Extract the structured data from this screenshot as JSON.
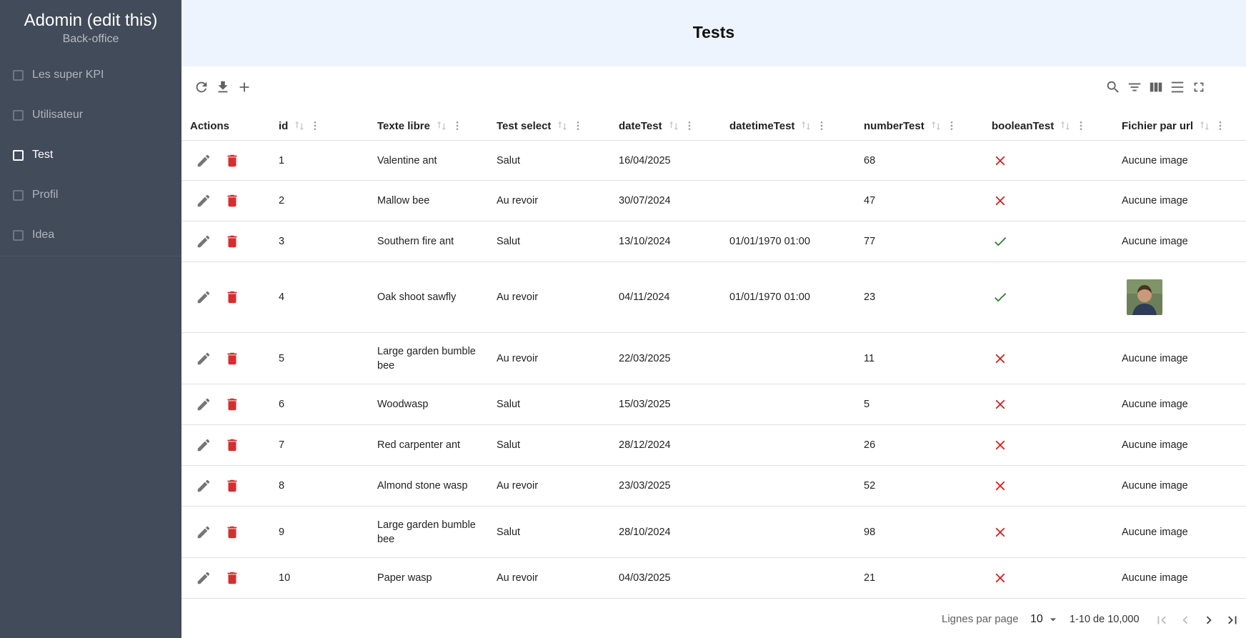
{
  "sidebar": {
    "title": "Adomin (edit this)",
    "subtitle": "Back-office",
    "items": [
      {
        "label": "Les super KPI",
        "active": false
      },
      {
        "label": "Utilisateur",
        "active": false
      },
      {
        "label": "Test",
        "active": true
      },
      {
        "label": "Profil",
        "active": false
      },
      {
        "label": "Idea",
        "active": false
      }
    ]
  },
  "header": {
    "title": "Tests"
  },
  "toolbar": {
    "left": [
      "refresh-icon",
      "download-icon",
      "add-icon"
    ],
    "right": [
      "search-icon",
      "filter-icon",
      "columns-icon",
      "density-icon",
      "fullscreen-icon"
    ]
  },
  "table": {
    "columns": [
      "Actions",
      "id",
      "Texte libre",
      "Test select",
      "dateTest",
      "datetimeTest",
      "numberTest",
      "booleanTest",
      "Fichier par url"
    ],
    "rows": [
      {
        "id": "1",
        "texte": "Valentine ant",
        "select": "Salut",
        "date": "16/04/2025",
        "datetime": "",
        "number": "68",
        "bool": false,
        "fichier": "Aucune image"
      },
      {
        "id": "2",
        "texte": "Mallow bee",
        "select": "Au revoir",
        "date": "30/07/2024",
        "datetime": "",
        "number": "47",
        "bool": false,
        "fichier": "Aucune image"
      },
      {
        "id": "3",
        "texte": "Southern fire ant",
        "select": "Salut",
        "date": "13/10/2024",
        "datetime": "01/01/1970 01:00",
        "number": "77",
        "bool": true,
        "fichier": "Aucune image"
      },
      {
        "id": "4",
        "texte": "Oak shoot sawfly",
        "select": "Au revoir",
        "date": "04/11/2024",
        "datetime": "01/01/1970 01:00",
        "number": "23",
        "bool": true,
        "fichier": ""
      },
      {
        "id": "5",
        "texte": "Large garden bumble bee",
        "select": "Au revoir",
        "date": "22/03/2025",
        "datetime": "",
        "number": "11",
        "bool": false,
        "fichier": "Aucune image"
      },
      {
        "id": "6",
        "texte": "Woodwasp",
        "select": "Salut",
        "date": "15/03/2025",
        "datetime": "",
        "number": "5",
        "bool": false,
        "fichier": "Aucune image"
      },
      {
        "id": "7",
        "texte": "Red carpenter ant",
        "select": "Salut",
        "date": "28/12/2024",
        "datetime": "",
        "number": "26",
        "bool": false,
        "fichier": "Aucune image"
      },
      {
        "id": "8",
        "texte": "Almond stone wasp",
        "select": "Au revoir",
        "date": "23/03/2025",
        "datetime": "",
        "number": "52",
        "bool": false,
        "fichier": "Aucune image"
      },
      {
        "id": "9",
        "texte": "Large garden bumble bee",
        "select": "Salut",
        "date": "28/10/2024",
        "datetime": "",
        "number": "98",
        "bool": false,
        "fichier": "Aucune image"
      },
      {
        "id": "10",
        "texte": "Paper wasp",
        "select": "Au revoir",
        "date": "04/03/2025",
        "datetime": "",
        "number": "21",
        "bool": false,
        "fichier": "Aucune image"
      }
    ]
  },
  "pagination": {
    "rows_per_page_label": "Lignes par page",
    "rows_per_page_value": "10",
    "range": "1-10 de 10,000"
  },
  "colors": {
    "sidebar_bg": "#424b59",
    "header_bg": "#eef4fd",
    "delete_red": "#d32f2f",
    "false_red": "#e01b1b",
    "true_green": "#2e7d32"
  }
}
